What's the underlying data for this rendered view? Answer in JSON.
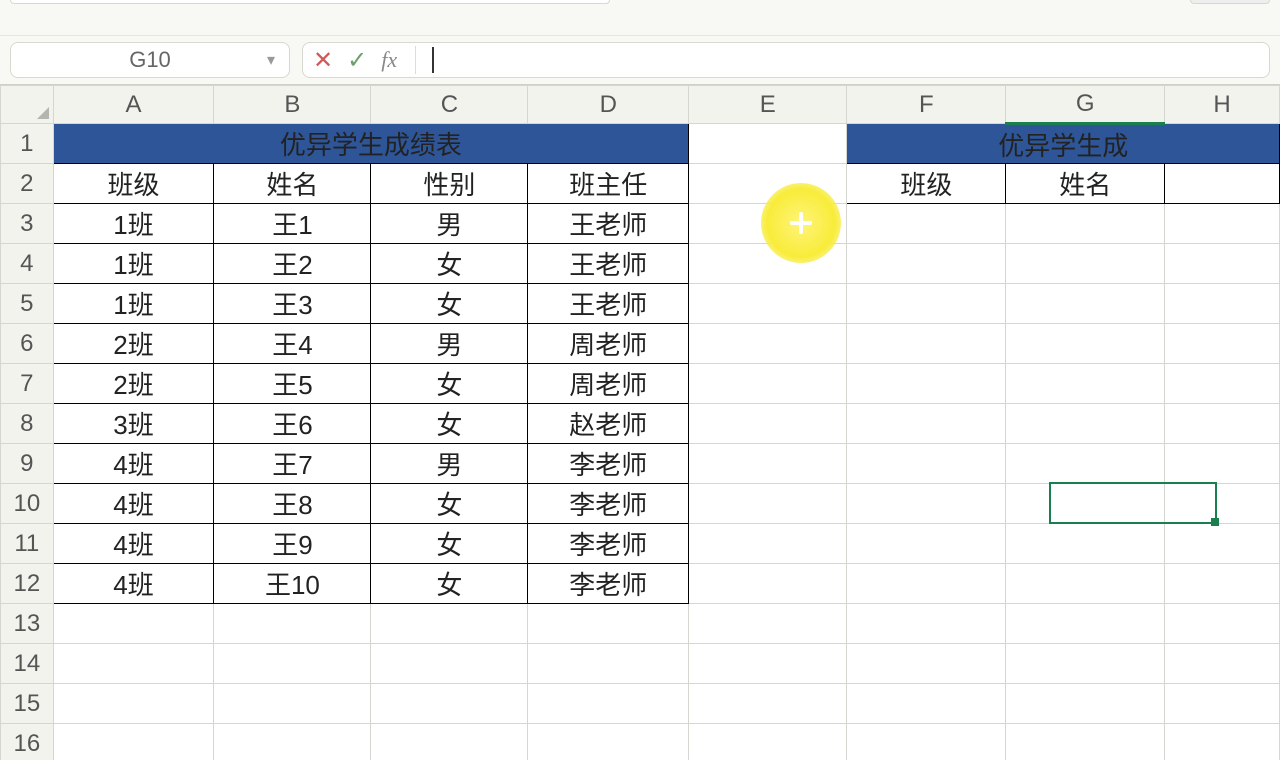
{
  "name_box": {
    "value": "G10"
  },
  "formula_bar": {
    "cancel_glyph": "✕",
    "accept_glyph": "✓",
    "fx_label": "fx",
    "input_value": ""
  },
  "columns": [
    "A",
    "B",
    "C",
    "D",
    "E",
    "F",
    "G",
    "H"
  ],
  "rows": [
    "1",
    "2",
    "3",
    "4",
    "5",
    "6",
    "7",
    "8",
    "9",
    "10",
    "11",
    "12",
    "13",
    "14",
    "15",
    "16"
  ],
  "active_cell": {
    "col": "G",
    "row": "10"
  },
  "table_left": {
    "title": "优异学生成绩表",
    "headers": [
      "班级",
      "姓名",
      "性别",
      "班主任"
    ],
    "rows": [
      [
        "1班",
        "王1",
        "男",
        "王老师"
      ],
      [
        "1班",
        "王2",
        "女",
        "王老师"
      ],
      [
        "1班",
        "王3",
        "女",
        "王老师"
      ],
      [
        "2班",
        "王4",
        "男",
        "周老师"
      ],
      [
        "2班",
        "王5",
        "女",
        "周老师"
      ],
      [
        "3班",
        "王6",
        "女",
        "赵老师"
      ],
      [
        "4班",
        "王7",
        "男",
        "李老师"
      ],
      [
        "4班",
        "王8",
        "女",
        "李老师"
      ],
      [
        "4班",
        "王9",
        "女",
        "李老师"
      ],
      [
        "4班",
        "王10",
        "女",
        "李老师"
      ]
    ]
  },
  "table_right": {
    "title": "优异学生成",
    "headers": [
      "班级",
      "姓名"
    ]
  },
  "chart_data": {
    "type": "table",
    "title": "优异学生成绩表",
    "columns": [
      "班级",
      "姓名",
      "性别",
      "班主任"
    ],
    "rows": [
      [
        "1班",
        "王1",
        "男",
        "王老师"
      ],
      [
        "1班",
        "王2",
        "女",
        "王老师"
      ],
      [
        "1班",
        "王3",
        "女",
        "王老师"
      ],
      [
        "2班",
        "王4",
        "男",
        "周老师"
      ],
      [
        "2班",
        "王5",
        "女",
        "周老师"
      ],
      [
        "3班",
        "王6",
        "女",
        "赵老师"
      ],
      [
        "4班",
        "王7",
        "男",
        "李老师"
      ],
      [
        "4班",
        "王8",
        "女",
        "李老师"
      ],
      [
        "4班",
        "王9",
        "女",
        "李老师"
      ],
      [
        "4班",
        "王10",
        "女",
        "李老师"
      ]
    ]
  }
}
